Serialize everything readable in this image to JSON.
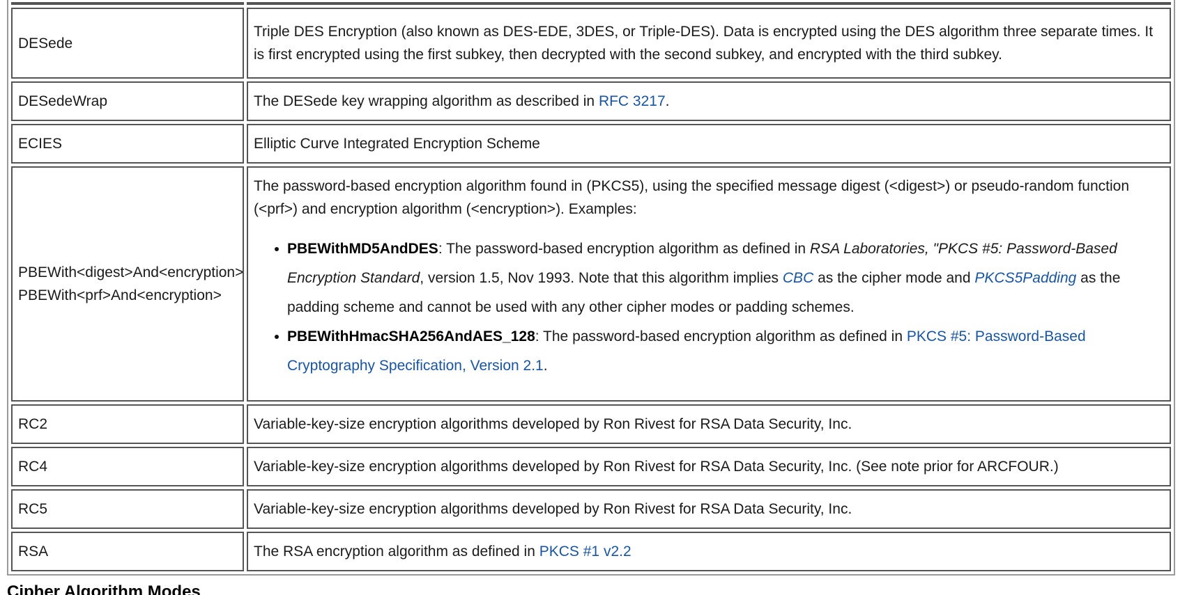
{
  "rows": [
    {
      "name": "DESede",
      "description": "Triple DES Encryption (also known as DES-EDE, 3DES, or Triple-DES). Data is encrypted using the DES algorithm three separate times. It is first encrypted using the first subkey, then decrypted with the second subkey, and encrypted with the third subkey."
    },
    {
      "name": "DESedeWrap",
      "description_pre": "The DESede key wrapping algorithm as described in ",
      "link": "RFC 3217",
      "description_post": "."
    },
    {
      "name": "ECIES",
      "description": "Elliptic Curve Integrated Encryption Scheme"
    },
    {
      "name_line1": "PBEWith<digest>And<encryption>",
      "name_line2": "PBEWith<prf>And<encryption>",
      "intro": "The password-based encryption algorithm found in (PKCS5), using the specified message digest (<digest>) or pseudo-random function (<prf>) and encryption algorithm (<encryption>). Examples:",
      "examples": [
        {
          "term": "PBEWithMD5AndDES",
          "text1": ": The password-based encryption algorithm as defined in ",
          "cite": "RSA Laboratories, \"PKCS #5: Password-Based Encryption Standard",
          "text2": ", version 1.5, Nov 1993. Note that this algorithm implies ",
          "link1": "CBC",
          "text3": " as the cipher mode and ",
          "link2": "PKCS5Padding",
          "text4": " as the padding scheme and cannot be used with any other cipher modes or padding schemes."
        },
        {
          "term": "PBEWithHmacSHA256AndAES_128",
          "text1": ": The password-based encryption algorithm as defined in ",
          "link1": "PKCS #5: Password-Based Cryptography Specification, Version 2.1",
          "text2": "."
        }
      ]
    },
    {
      "name": "RC2",
      "description": "Variable-key-size encryption algorithms developed by Ron Rivest for RSA Data Security, Inc."
    },
    {
      "name": "RC4",
      "description": "Variable-key-size encryption algorithms developed by Ron Rivest for RSA Data Security, Inc. (See note prior for ARCFOUR.)"
    },
    {
      "name": "RC5",
      "description": "Variable-key-size encryption algorithms developed by Ron Rivest for RSA Data Security, Inc."
    },
    {
      "name": "RSA",
      "description_pre": "The RSA encryption algorithm as defined in ",
      "link": "PKCS #1 v2.2"
    }
  ],
  "next_heading": "Cipher Algorithm Modes",
  "colors": {
    "link": "#1a55a0",
    "cell_border": "#555555",
    "table_border": "#9a9a9a"
  }
}
